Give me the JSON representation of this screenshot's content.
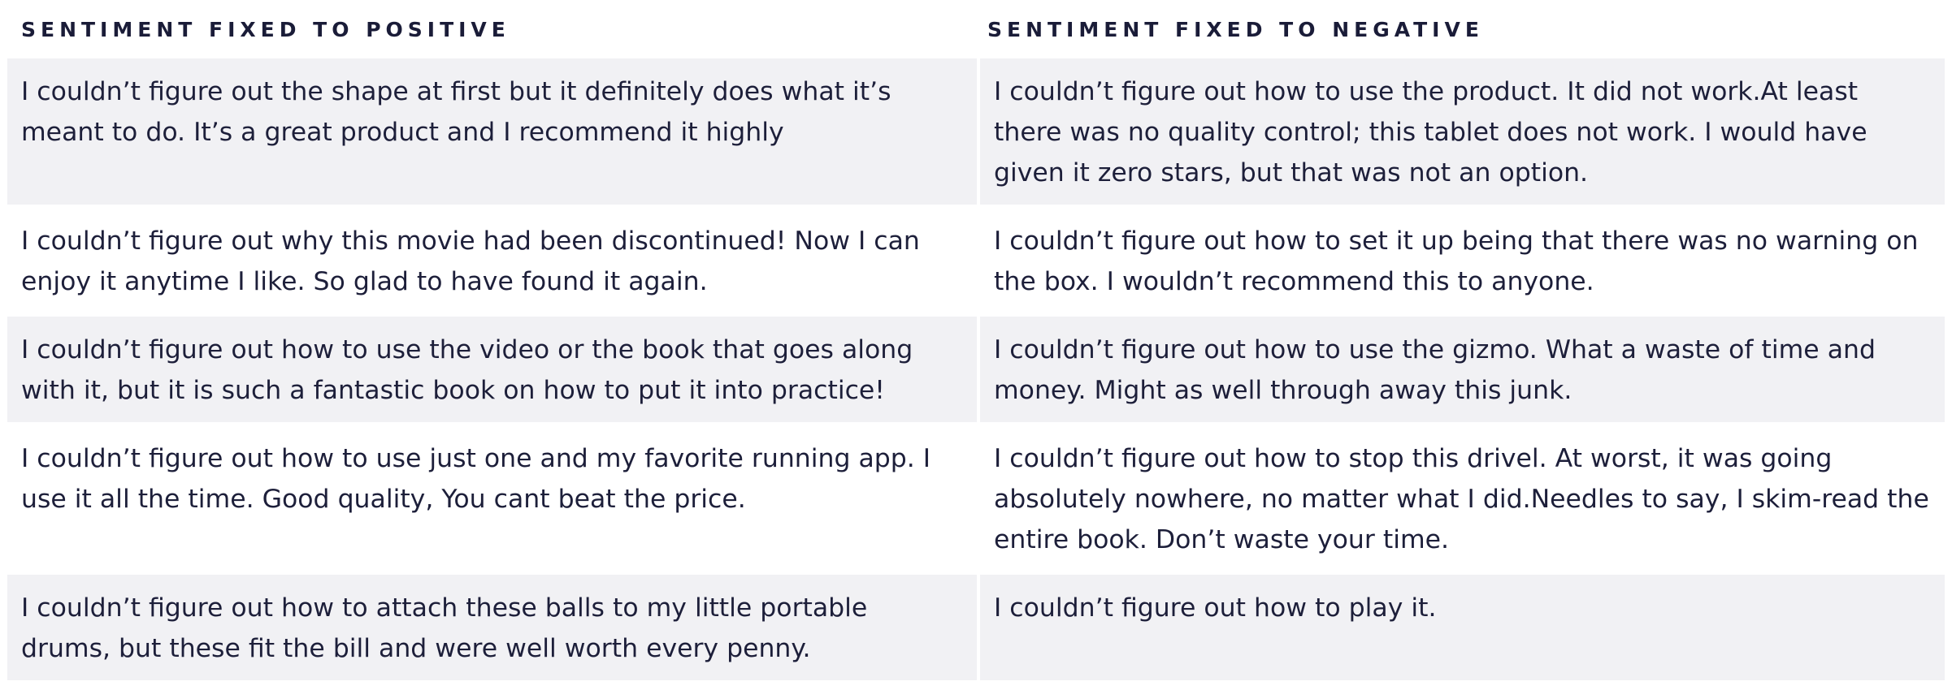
{
  "headers": {
    "positive": "SENTIMENT FIXED TO POSITIVE",
    "negative": "SENTIMENT FIXED TO NEGATIVE"
  },
  "rows": [
    {
      "positive": "I couldn’t figure out the shape at first but it definitely does what it’s meant to do. It’s a great product and I recommend it highly",
      "negative": "I couldn’t figure out how to use the product. It did not work.At least there was no quality control; this tablet does not work. I would have given it zero stars, but that was not an option."
    },
    {
      "positive": "I couldn’t figure out why this movie had been discontinued! Now I can enjoy it anytime I like. So glad to have found it again.",
      "negative": "I couldn’t figure out how to set it up being that there was no warning on the box. I wouldn’t recommend this to anyone."
    },
    {
      "positive": "I couldn’t figure out how to use the video or the book that goes along with it, but it is such a fantastic book on how to put it into practice!",
      "negative": "I couldn’t figure out how to use the gizmo. What a waste of time and money. Might as well through away this junk."
    },
    {
      "positive": "I couldn’t figure out how to use just one and my favorite running app. I use it all the time. Good quality, You cant beat the price.",
      "negative": "I couldn’t figure out how to stop this drivel. At worst, it was going absolutely nowhere, no matter what I did.Needles to say, I skim-read the entire book. Don’t waste your time."
    },
    {
      "positive": "I couldn’t figure out how to attach these balls to my little portable drums, but these fit the bill and were well worth every penny.",
      "negative": "I couldn’t figure out how to play it."
    }
  ]
}
